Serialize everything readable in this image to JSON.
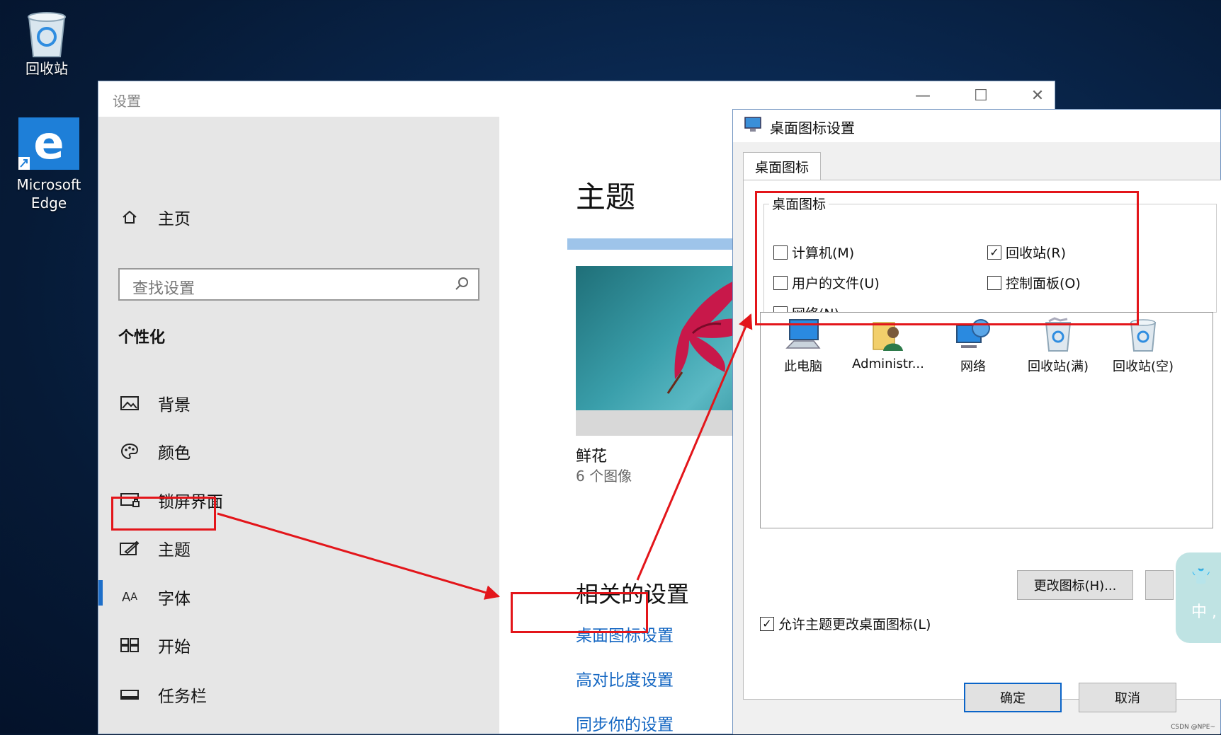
{
  "desktop": {
    "icons": [
      {
        "label": "回收站",
        "icon": "recycle-bin-icon"
      },
      {
        "label": "Microsoft\nEdge",
        "icon": "edge-icon"
      }
    ]
  },
  "settings": {
    "window_title": "设置",
    "controls": {
      "minimize": "—",
      "maximize": "☐",
      "close": "✕"
    },
    "sidebar": {
      "home": "主页",
      "search_placeholder": "查找设置",
      "section": "个性化",
      "items": [
        {
          "label": "背景",
          "icon": "picture-icon"
        },
        {
          "label": "颜色",
          "icon": "palette-icon"
        },
        {
          "label": "锁屏界面",
          "icon": "lock-screen-icon"
        },
        {
          "label": "主题",
          "icon": "theme-brush-icon",
          "active": true
        },
        {
          "label": "字体",
          "icon": "font-icon"
        },
        {
          "label": "开始",
          "icon": "start-grid-icon"
        },
        {
          "label": "任务栏",
          "icon": "taskbar-icon"
        }
      ]
    },
    "main": {
      "title": "主题",
      "theme_name": "鲜花",
      "theme_count": "6 个图像",
      "related_heading": "相关的设置",
      "links": [
        "桌面图标设置",
        "高对比度设置",
        "同步你的设置"
      ]
    }
  },
  "dialog": {
    "title": "桌面图标设置",
    "tab": "桌面图标",
    "group_label": "桌面图标",
    "checkboxes": [
      {
        "label": "计算机(M)",
        "checked": false
      },
      {
        "label": "回收站(R)",
        "checked": true
      },
      {
        "label": "用户的文件(U)",
        "checked": false
      },
      {
        "label": "控制面板(O)",
        "checked": false
      },
      {
        "label": "网络(N)",
        "checked": false
      }
    ],
    "icons": [
      "此电脑",
      "Administr...",
      "网络",
      "回收站(满)",
      "回收站(空)"
    ],
    "change_icon_button": "更改图标(H)...",
    "allow_theme": {
      "label": "允许主题更改桌面图标(L)",
      "checked": true
    },
    "ok": "确定",
    "cancel": "取消"
  },
  "ime": {
    "shirt": "👕",
    "lang": "中 ,"
  },
  "watermark": "CSDN @NPE~",
  "colors": {
    "accent": "#1e6fc9",
    "link": "#1366c2",
    "annotation": "#e3151a"
  }
}
